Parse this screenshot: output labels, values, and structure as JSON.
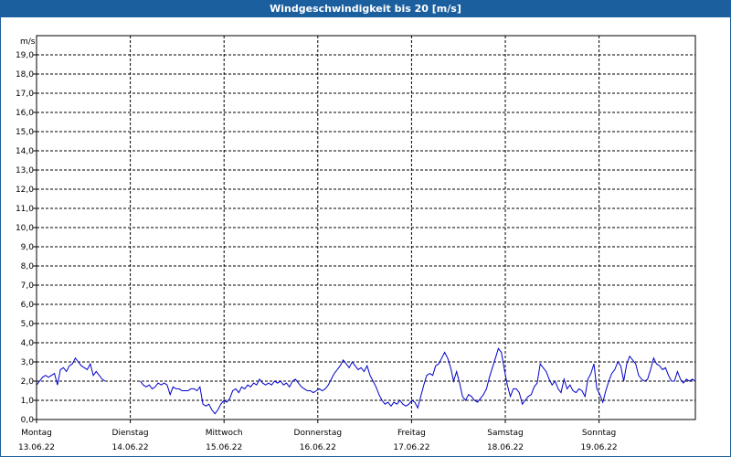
{
  "title": "Windgeschwindigkeit bis 20 [m/s]",
  "colors": {
    "title_bg": "#1c5f9e",
    "series": "#0000c8",
    "grid": "#000000"
  },
  "chart_data": {
    "type": "line",
    "title": "Windgeschwindigkeit bis 20 [m/s]",
    "ylabel": "m/s",
    "ylim": [
      0,
      20
    ],
    "yticks": [
      "0,0",
      "1,0",
      "2,0",
      "3,0",
      "4,0",
      "5,0",
      "6,0",
      "7,0",
      "8,0",
      "9,0",
      "10,0",
      "11,0",
      "12,0",
      "13,0",
      "14,0",
      "15,0",
      "16,0",
      "17,0",
      "18,0",
      "19,0"
    ],
    "xlim": [
      0,
      7
    ],
    "grid": true,
    "x_ticks": [
      {
        "day": "Montag",
        "date": "13.06.22"
      },
      {
        "day": "Dienstag",
        "date": "14.06.22"
      },
      {
        "day": "Mittwoch",
        "date": "15.06.22"
      },
      {
        "day": "Donnerstag",
        "date": "16.06.22"
      },
      {
        "day": "Freitag",
        "date": "17.06.22"
      },
      {
        "day": "Samstag",
        "date": "18.06.22"
      },
      {
        "day": "Sonntag",
        "date": "19.06.22"
      }
    ],
    "series": [
      {
        "segments": [
          [
            [
              0.0,
              1.8
            ],
            [
              0.04,
              2.0
            ],
            [
              0.08,
              2.2
            ],
            [
              0.12,
              2.3
            ],
            [
              0.16,
              2.2
            ],
            [
              0.2,
              2.3
            ],
            [
              0.24,
              2.4
            ],
            [
              0.28,
              1.8
            ],
            [
              0.32,
              2.6
            ],
            [
              0.36,
              2.7
            ],
            [
              0.4,
              2.5
            ],
            [
              0.44,
              2.8
            ],
            [
              0.48,
              2.9
            ],
            [
              0.52,
              3.2
            ],
            [
              0.56,
              3.0
            ],
            [
              0.6,
              2.8
            ],
            [
              0.64,
              2.7
            ],
            [
              0.68,
              2.6
            ],
            [
              0.72,
              2.9
            ],
            [
              0.76,
              2.3
            ],
            [
              0.8,
              2.5
            ],
            [
              0.84,
              2.3
            ],
            [
              0.88,
              2.1
            ],
            [
              0.92,
              2.0
            ]
          ],
          [
            [
              1.39,
              2.0
            ],
            [
              1.43,
              1.8
            ],
            [
              1.47,
              1.7
            ],
            [
              1.51,
              1.8
            ],
            [
              1.55,
              1.6
            ],
            [
              1.59,
              1.7
            ],
            [
              1.63,
              1.9
            ],
            [
              1.67,
              1.8
            ],
            [
              1.71,
              1.9
            ],
            [
              1.75,
              1.8
            ],
            [
              1.79,
              1.3
            ],
            [
              1.83,
              1.7
            ],
            [
              1.87,
              1.6
            ],
            [
              1.91,
              1.6
            ],
            [
              1.95,
              1.5
            ],
            [
              1.99,
              1.5
            ],
            [
              2.03,
              1.5
            ],
            [
              2.07,
              1.6
            ],
            [
              2.11,
              1.6
            ],
            [
              2.15,
              1.5
            ],
            [
              2.19,
              1.7
            ],
            [
              2.23,
              0.8
            ],
            [
              2.27,
              0.7
            ],
            [
              2.31,
              0.8
            ],
            [
              2.35,
              0.5
            ],
            [
              2.39,
              0.3
            ],
            [
              2.43,
              0.5
            ],
            [
              2.47,
              0.8
            ],
            [
              2.51,
              1.0
            ],
            [
              2.55,
              0.9
            ],
            [
              2.59,
              1.1
            ],
            [
              2.63,
              1.5
            ],
            [
              2.67,
              1.6
            ],
            [
              2.71,
              1.4
            ],
            [
              2.75,
              1.7
            ],
            [
              2.79,
              1.6
            ],
            [
              2.83,
              1.8
            ],
            [
              2.87,
              1.7
            ],
            [
              2.91,
              1.9
            ],
            [
              2.95,
              1.8
            ],
            [
              2.99,
              2.1
            ],
            [
              3.03,
              1.9
            ],
            [
              3.07,
              1.8
            ],
            [
              3.11,
              1.9
            ],
            [
              3.15,
              1.8
            ],
            [
              3.19,
              2.0
            ],
            [
              3.23,
              1.9
            ],
            [
              3.27,
              2.0
            ],
            [
              3.31,
              1.8
            ],
            [
              3.35,
              1.9
            ],
            [
              3.39,
              1.7
            ],
            [
              3.43,
              2.0
            ],
            [
              3.47,
              2.1
            ],
            [
              3.51,
              1.9
            ],
            [
              3.55,
              1.7
            ],
            [
              3.59,
              1.6
            ],
            [
              3.63,
              1.5
            ],
            [
              3.67,
              1.5
            ],
            [
              3.71,
              1.4
            ],
            [
              3.75,
              1.5
            ],
            [
              3.79,
              1.6
            ],
            [
              3.83,
              1.5
            ],
            [
              3.87,
              1.6
            ],
            [
              3.91,
              1.8
            ],
            [
              3.95,
              2.1
            ],
            [
              3.99,
              2.4
            ],
            [
              4.03,
              2.6
            ],
            [
              4.07,
              2.8
            ],
            [
              4.11,
              3.1
            ],
            [
              4.15,
              2.9
            ],
            [
              4.19,
              2.7
            ],
            [
              4.23,
              3.0
            ],
            [
              4.27,
              2.8
            ],
            [
              4.31,
              2.6
            ],
            [
              4.35,
              2.7
            ],
            [
              4.39,
              2.5
            ],
            [
              4.43,
              2.8
            ],
            [
              4.47,
              2.3
            ],
            [
              4.51,
              2.0
            ],
            [
              4.55,
              1.7
            ],
            [
              4.59,
              1.3
            ],
            [
              4.63,
              1.0
            ],
            [
              4.67,
              0.8
            ],
            [
              4.71,
              0.9
            ],
            [
              4.75,
              0.7
            ],
            [
              4.79,
              0.9
            ],
            [
              4.83,
              0.8
            ],
            [
              4.87,
              1.0
            ],
            [
              4.91,
              0.8
            ],
            [
              4.95,
              0.7
            ],
            [
              4.99,
              0.8
            ],
            [
              5.03,
              1.0
            ],
            [
              5.07,
              0.9
            ],
            [
              5.11,
              0.6
            ],
            [
              5.15,
              1.2
            ],
            [
              5.19,
              1.8
            ],
            [
              5.23,
              2.3
            ],
            [
              5.27,
              2.4
            ],
            [
              5.31,
              2.3
            ],
            [
              5.35,
              2.8
            ],
            [
              5.39,
              2.9
            ],
            [
              5.43,
              3.2
            ],
            [
              5.47,
              3.5
            ],
            [
              5.51,
              3.2
            ],
            [
              5.55,
              2.7
            ],
            [
              5.59,
              2.0
            ],
            [
              5.63,
              2.5
            ],
            [
              5.67,
              1.9
            ],
            [
              5.71,
              1.2
            ],
            [
              5.75,
              1.0
            ],
            [
              5.79,
              1.3
            ],
            [
              5.83,
              1.2
            ],
            [
              5.87,
              1.0
            ],
            [
              5.91,
              0.9
            ],
            [
              5.95,
              1.1
            ],
            [
              5.99,
              1.3
            ],
            [
              6.03,
              1.6
            ],
            [
              6.07,
              2.2
            ],
            [
              6.11,
              2.7
            ],
            [
              6.15,
              3.2
            ],
            [
              6.19,
              3.7
            ],
            [
              6.23,
              3.5
            ],
            [
              6.27,
              2.6
            ],
            [
              6.31,
              1.8
            ],
            [
              6.35,
              1.2
            ],
            [
              6.39,
              1.6
            ],
            [
              6.43,
              1.6
            ],
            [
              6.47,
              1.4
            ],
            [
              6.51,
              0.8
            ],
            [
              6.55,
              1.0
            ],
            [
              6.59,
              1.2
            ],
            [
              6.63,
              1.3
            ],
            [
              6.67,
              1.7
            ],
            [
              6.71,
              1.9
            ],
            [
              6.75,
              2.9
            ],
            [
              6.79,
              2.7
            ],
            [
              6.83,
              2.5
            ],
            [
              6.87,
              2.1
            ],
            [
              6.91,
              1.8
            ],
            [
              6.95,
              2.0
            ],
            [
              6.99,
              1.6
            ],
            [
              7.03,
              1.4
            ],
            [
              7.07,
              2.1
            ],
            [
              7.11,
              1.6
            ],
            [
              7.15,
              1.8
            ],
            [
              7.19,
              1.5
            ],
            [
              7.23,
              1.4
            ],
            [
              7.27,
              1.6
            ],
            [
              7.31,
              1.5
            ],
            [
              7.35,
              1.2
            ],
            [
              7.39,
              2.1
            ],
            [
              7.43,
              2.4
            ],
            [
              7.47,
              2.9
            ],
            [
              7.51,
              1.6
            ],
            [
              7.55,
              1.3
            ],
            [
              7.59,
              0.9
            ],
            [
              7.63,
              1.5
            ],
            [
              7.67,
              2.0
            ],
            [
              7.71,
              2.4
            ],
            [
              7.75,
              2.6
            ],
            [
              7.79,
              3.0
            ],
            [
              7.83,
              2.8
            ],
            [
              7.87,
              2.0
            ],
            [
              7.91,
              2.9
            ],
            [
              7.95,
              3.3
            ],
            [
              7.99,
              3.1
            ],
            [
              8.03,
              2.9
            ],
            [
              8.07,
              2.3
            ],
            [
              8.11,
              2.1
            ],
            [
              8.15,
              2.0
            ],
            [
              8.19,
              2.1
            ],
            [
              8.23,
              2.6
            ],
            [
              8.27,
              3.2
            ],
            [
              8.31,
              2.9
            ],
            [
              8.35,
              2.8
            ],
            [
              8.39,
              2.6
            ],
            [
              8.43,
              2.7
            ],
            [
              8.47,
              2.3
            ],
            [
              8.51,
              2.0
            ],
            [
              8.55,
              2.0
            ],
            [
              8.59,
              2.5
            ],
            [
              8.63,
              2.1
            ],
            [
              8.67,
              1.9
            ],
            [
              8.71,
              2.1
            ],
            [
              8.75,
              2.0
            ],
            [
              8.79,
              2.1
            ],
            [
              8.83,
              2.0
            ]
          ]
        ]
      }
    ]
  }
}
